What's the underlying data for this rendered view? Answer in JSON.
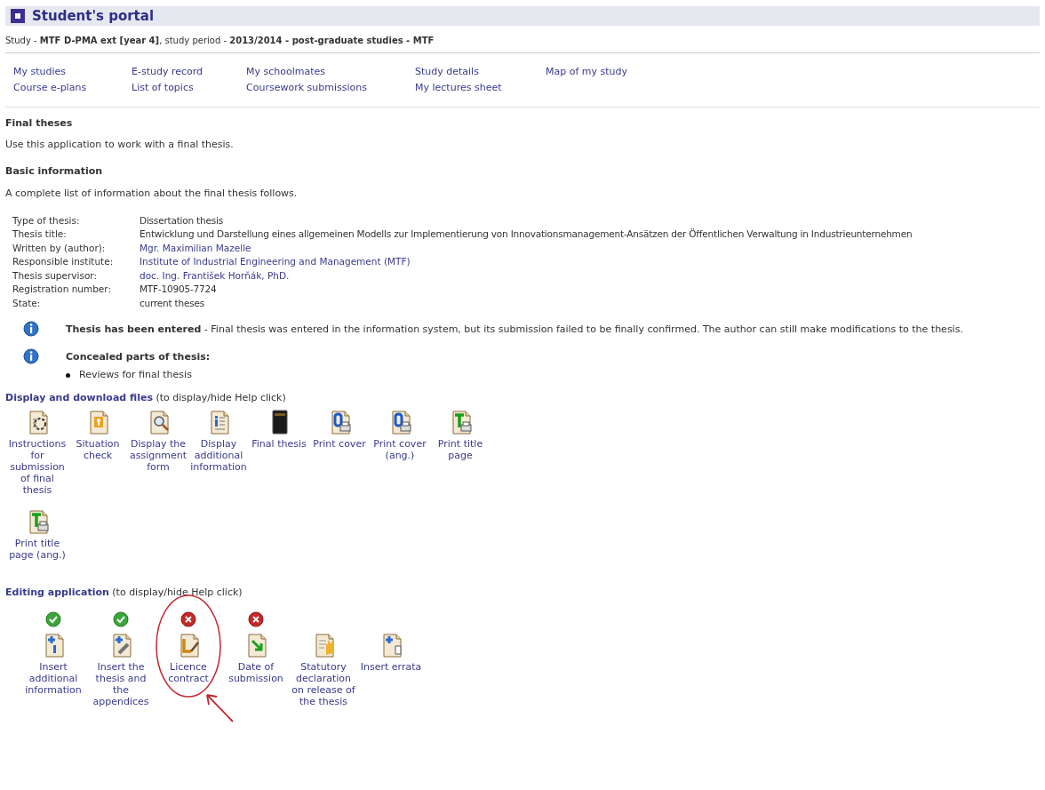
{
  "header": {
    "title": "Student's portal"
  },
  "study_line": "Study - **MTF D-PMA ext [year 4]**, study period - **2013/2014 - post-graduate studies - MTF**",
  "nav_links": [
    [
      "My studies",
      "Course e-plans"
    ],
    [
      "E-study record",
      "List of topics"
    ],
    [
      "My schoolmates",
      "Coursework submissions"
    ],
    [
      "Study details",
      "My lectures sheet"
    ],
    [
      "Map of my study"
    ]
  ],
  "section_title": "Final theses",
  "section_intro": "Use this application to work with a final thesis.",
  "basic_title": "Basic information",
  "basic_intro": "A complete list of information about the final thesis follows.",
  "info_rows": [
    {
      "label": "Type of thesis:",
      "value": "Dissertation thesis",
      "link": false
    },
    {
      "label": "Thesis title:",
      "value": "Entwicklung und Darstellung eines allgemeinen Modells zur Implementierung von Innovationsmanagement-Ansätzen der Öffentlichen Verwaltung in Industrieunternehmen",
      "link": false
    },
    {
      "label": "Written by (author):",
      "value": "Mgr. Maximilian Mazelle",
      "link": true
    },
    {
      "label": "Responsible institute:",
      "value": "Institute of Industrial Engineering and Management (MTF)",
      "link": true
    },
    {
      "label": "Thesis supervisor:",
      "value": "doc. Ing. František Horňák, PhD.",
      "link": true
    },
    {
      "label": "Registration number:",
      "value": "MTF-10905-7724",
      "link": false
    },
    {
      "label": "State:",
      "value": "current theses",
      "link": false
    }
  ],
  "notices": [
    {
      "text": "**Thesis has been entered** - Final thesis was entered in the information system, but its submission failed to be finally confirmed. The author can still make modifications to the thesis."
    },
    {
      "title": "Concealed parts of thesis:",
      "items": [
        "Reviews for final thesis"
      ]
    }
  ],
  "files_section": {
    "title": "Display and download files",
    "hint": "(to display/hide Help click)",
    "items": [
      "Instructions for submission of final thesis",
      "Situation check",
      "Display the assignment form",
      "Display additional information",
      "Final thesis",
      "Print cover",
      "Print cover (ang.)",
      "Print title page",
      "Print title page (ang.)"
    ]
  },
  "editing_section": {
    "title": "Editing application",
    "hint": "(to display/hide Help click)",
    "items": [
      {
        "label": "Insert additional information",
        "kind": "done"
      },
      {
        "label": "Insert the thesis and the appendices",
        "kind": "done"
      },
      {
        "label": "Licence contract",
        "kind": "missing",
        "highlighted": true
      },
      {
        "label": "Date of submission",
        "kind": "missing",
        "highlighted": false
      },
      {
        "label": "Statutory declaration on release of the thesis",
        "kind": "plain",
        "highlighted": false
      },
      {
        "label": "Insert errata",
        "kind": "plain",
        "highlighted": false
      }
    ]
  }
}
